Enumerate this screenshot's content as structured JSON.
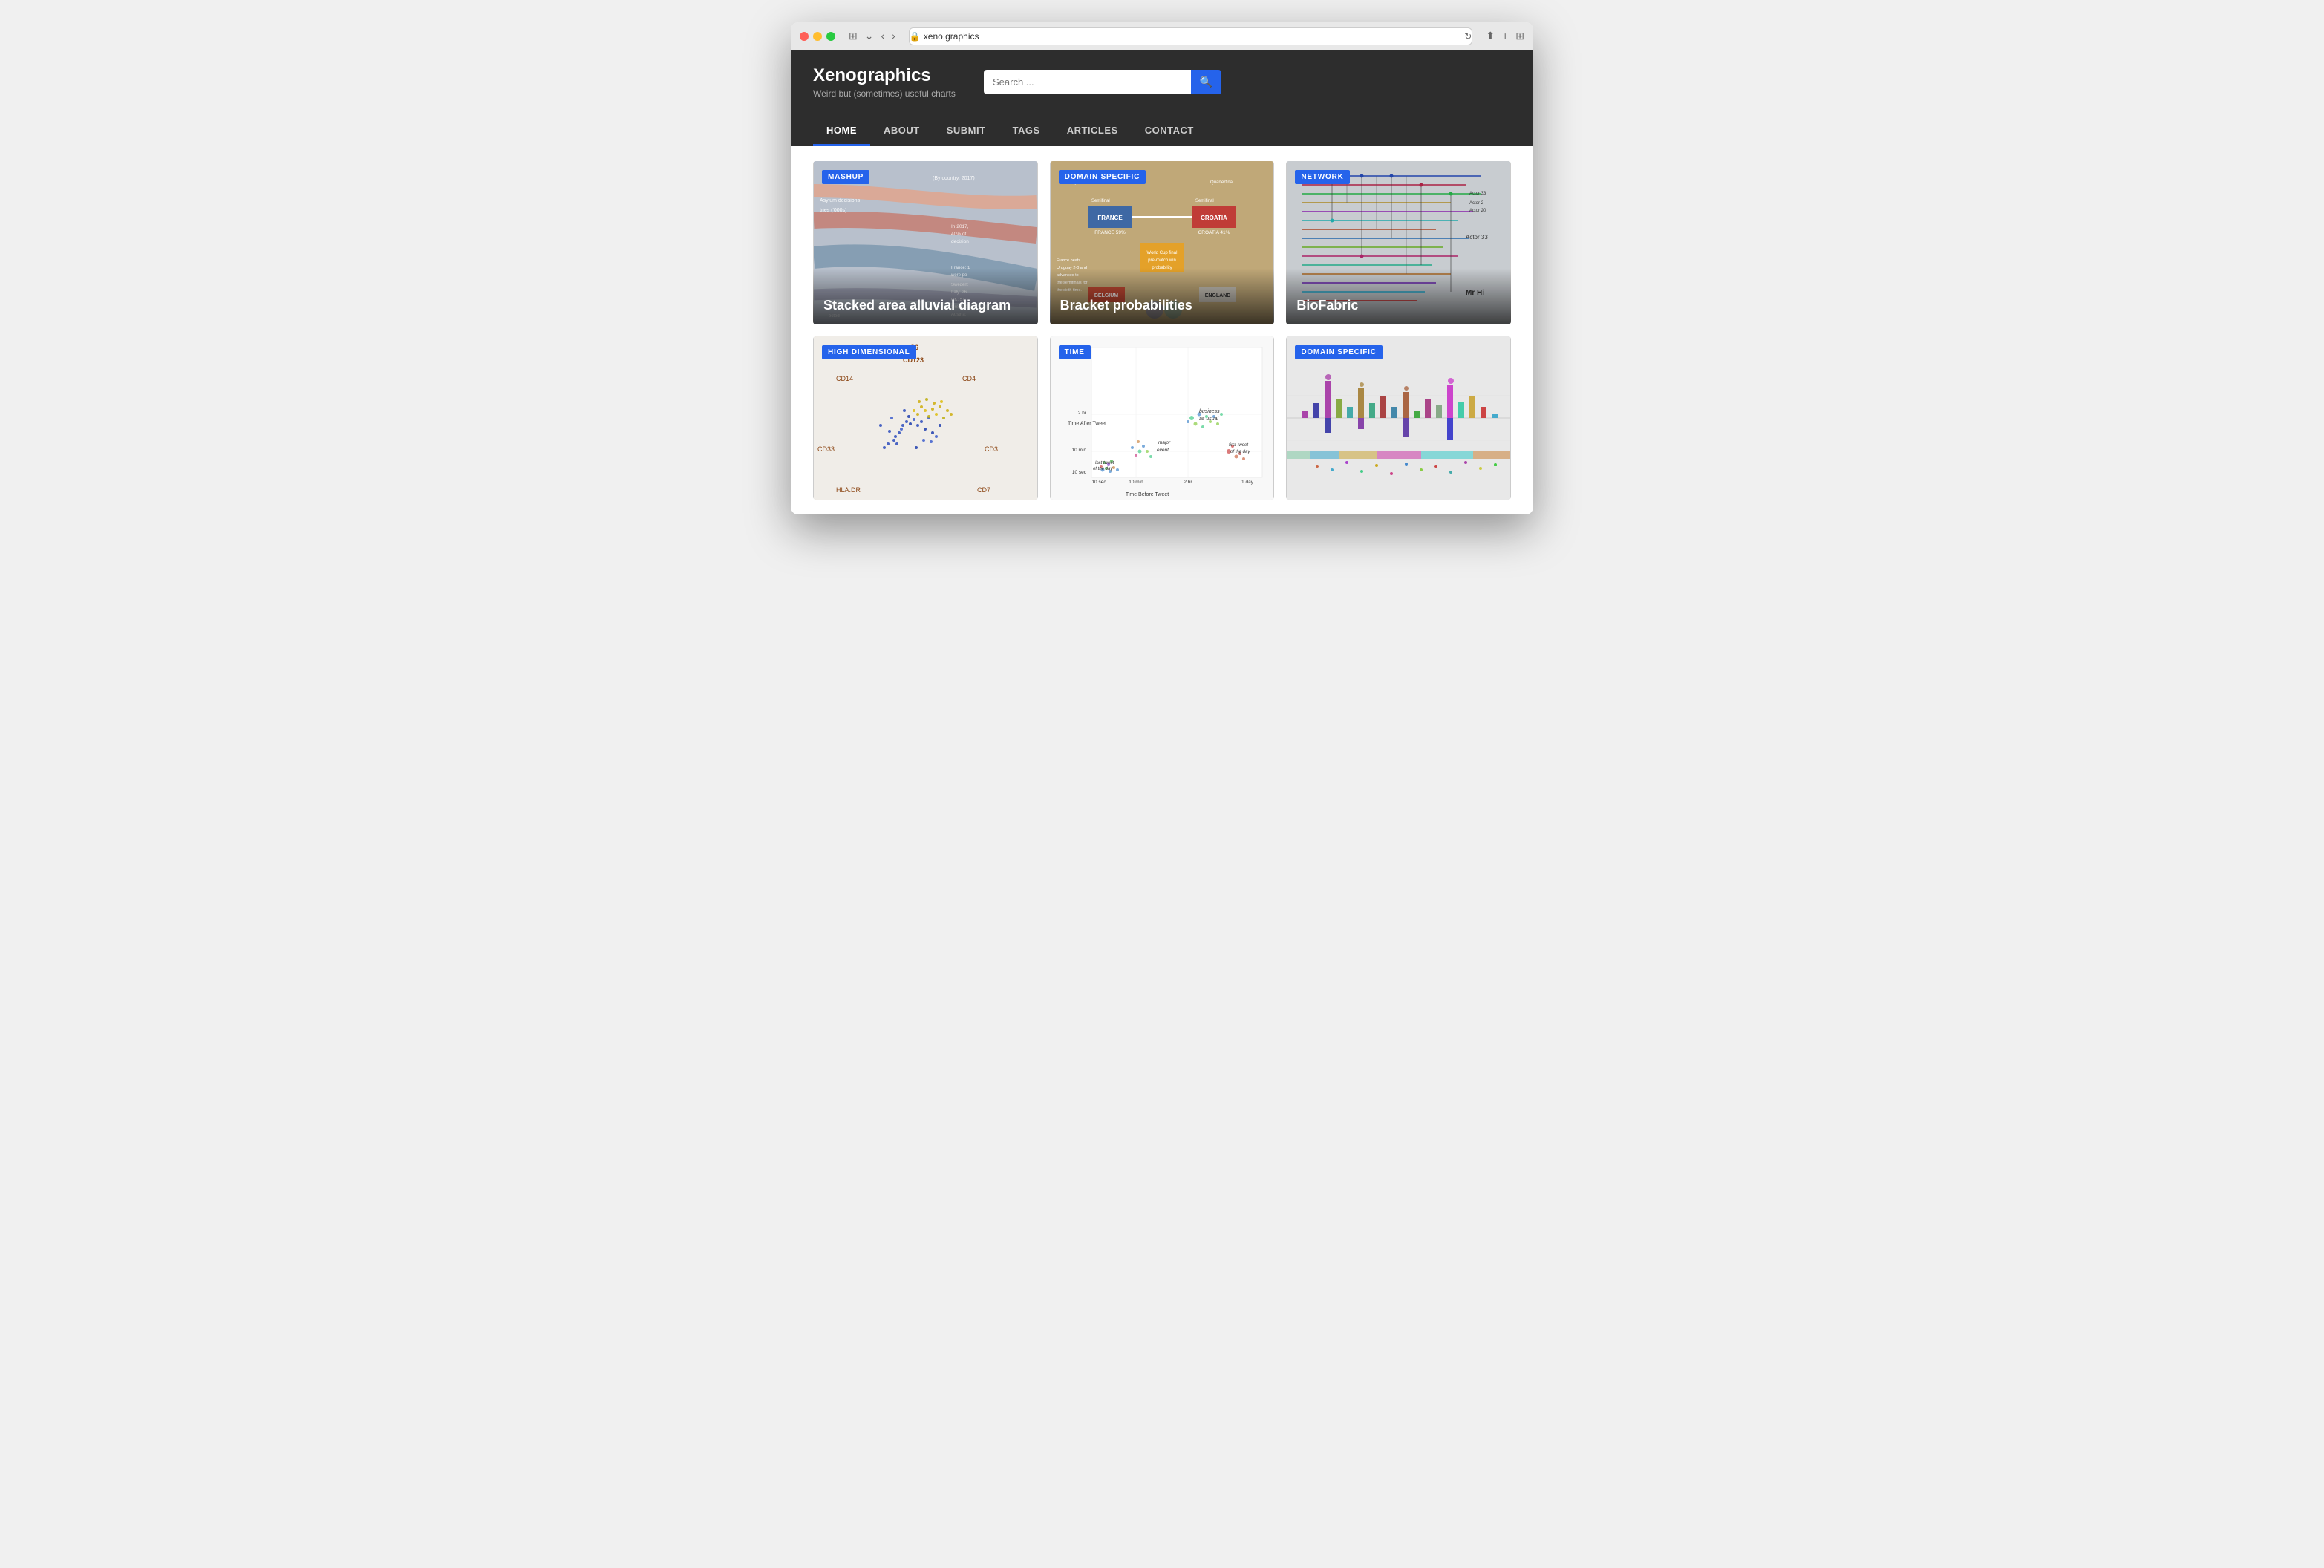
{
  "browser": {
    "url": "xeno.graphics",
    "shield_icon": "🛡",
    "reload_icon": "↻"
  },
  "site": {
    "title": "Xenographics",
    "subtitle": "Weird but (sometimes) useful charts",
    "search_placeholder": "Search ...",
    "search_button_label": "🔍"
  },
  "nav": {
    "items": [
      {
        "label": "HOME",
        "active": true
      },
      {
        "label": "ABOUT",
        "active": false
      },
      {
        "label": "SUBMIT",
        "active": false
      },
      {
        "label": "TAGS",
        "active": false
      },
      {
        "label": "ARTICLES",
        "active": false
      },
      {
        "label": "CONTACT",
        "active": false
      }
    ]
  },
  "cards": [
    {
      "tag": "MASHUP",
      "title": "Stacked area alluvial diagram",
      "viz_type": "alluvial"
    },
    {
      "tag": "DOMAIN SPECIFIC",
      "title": "Bracket probabilities",
      "viz_type": "bracket"
    },
    {
      "tag": "NETWORK",
      "title": "BioFabric",
      "viz_type": "network"
    },
    {
      "tag": "HIGH DIMENSIONAL",
      "title": "",
      "viz_type": "flow"
    },
    {
      "tag": "TIME",
      "title": "",
      "viz_type": "scatter"
    },
    {
      "tag": "DOMAIN SPECIFIC",
      "title": "",
      "viz_type": "domain2"
    }
  ]
}
